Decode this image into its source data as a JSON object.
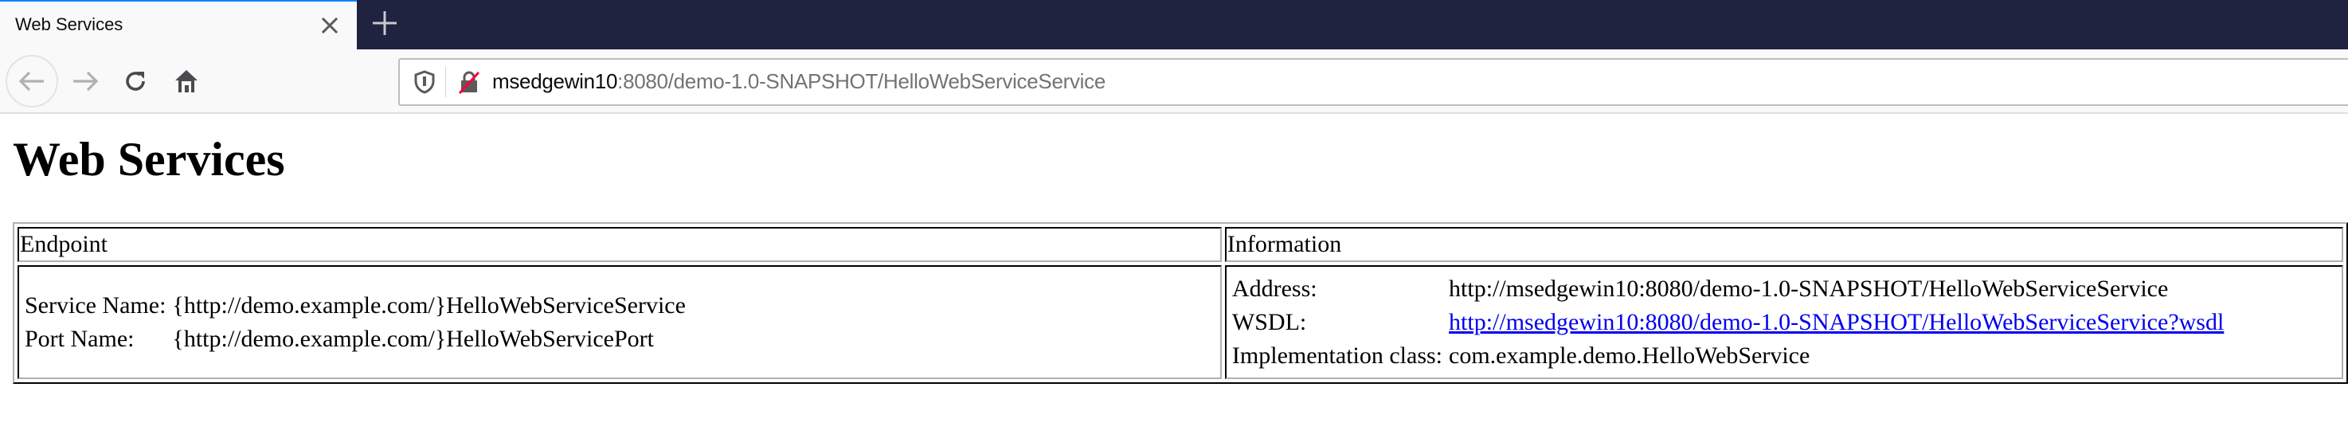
{
  "browser": {
    "tab": {
      "title": "Web Services",
      "close_icon": "close-icon"
    },
    "new_tab_icon": "plus-icon",
    "nav": {
      "back_icon": "arrow-left-icon",
      "forward_icon": "arrow-right-icon",
      "reload_icon": "reload-icon",
      "home_icon": "home-icon"
    },
    "urlbar": {
      "shield_icon": "shield-icon",
      "lock_icon": "insecure-lock-icon",
      "host": "msedgewin10",
      "rest": ":8080/demo-1.0-SNAPSHOT/HelloWebServiceService"
    },
    "colors": {
      "tabstrip_bg": "#1f2340",
      "active_tab_accent": "#0a84ff",
      "link": "#0000ee"
    }
  },
  "page": {
    "title": "Web Services",
    "table": {
      "headers": [
        "Endpoint",
        "Information"
      ],
      "endpoint": [
        {
          "label": "Service Name:",
          "value": "{http://demo.example.com/}HelloWebServiceService"
        },
        {
          "label": "Port Name:",
          "value": "{http://demo.example.com/}HelloWebServicePort"
        }
      ],
      "information": [
        {
          "label": "Address:",
          "value": "http://msedgewin10:8080/demo-1.0-SNAPSHOT/HelloWebServiceService"
        },
        {
          "label": "WSDL:",
          "value": "http://msedgewin10:8080/demo-1.0-SNAPSHOT/HelloWebServiceService?wsdl"
        },
        {
          "label": "Implementation class:",
          "value": "com.example.demo.HelloWebService"
        }
      ]
    }
  }
}
